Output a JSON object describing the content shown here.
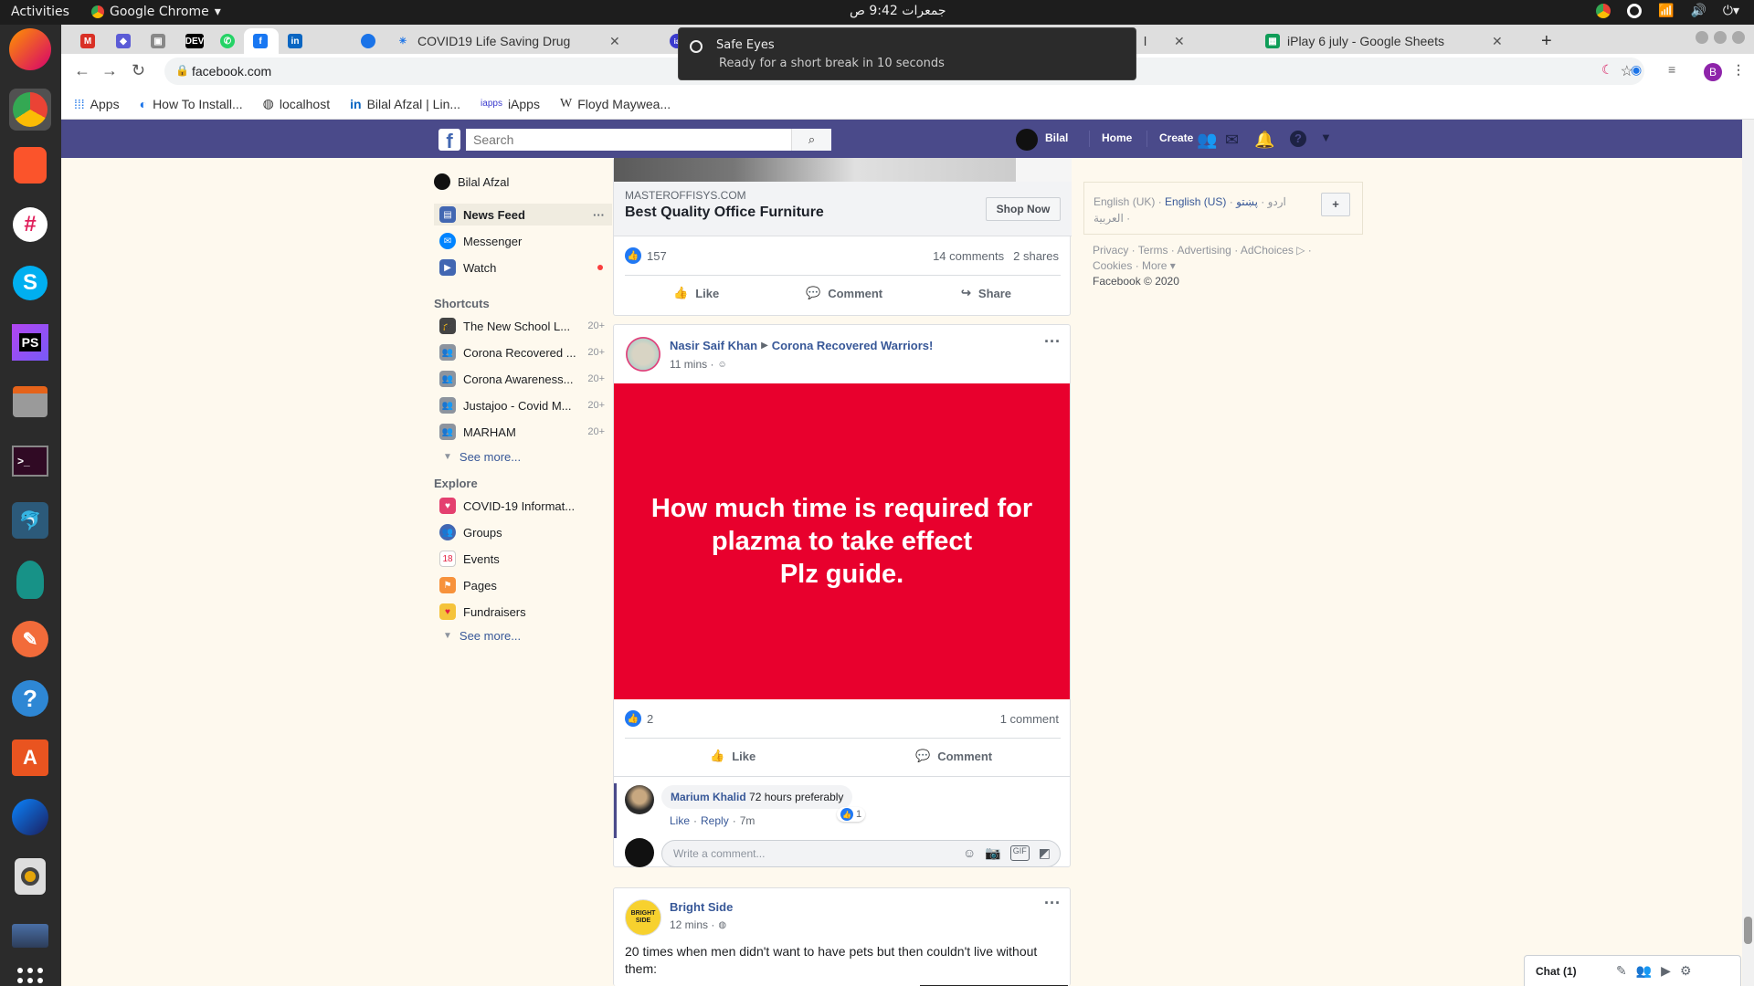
{
  "os": {
    "activities": "Activities",
    "app_name": "Google Chrome",
    "clock": "جمعرات 9:42 ص"
  },
  "notification": {
    "title": "Safe Eyes",
    "body": "Ready for a short break in 10 seconds"
  },
  "tabs": [
    {
      "label": "COVID19 Life Saving Drug"
    },
    {
      "label": "iApps"
    },
    {
      "label": "iPlay 6 july - Google Sheets"
    }
  ],
  "address_bar": {
    "url": "facebook.com"
  },
  "bookmarks": [
    {
      "label": "Apps"
    },
    {
      "label": "How To Install..."
    },
    {
      "label": "localhost"
    },
    {
      "label": "Bilal Afzal | Lin..."
    },
    {
      "label": "iApps"
    },
    {
      "label": "Floyd Maywea..."
    }
  ],
  "profile_initial": "B",
  "facebook": {
    "search_placeholder": "Search",
    "nav": {
      "user": "Bilal",
      "home": "Home",
      "create": "Create"
    },
    "left": {
      "profile_name": "Bilal Afzal",
      "main_items": [
        {
          "label": "News Feed"
        },
        {
          "label": "Messenger"
        },
        {
          "label": "Watch"
        }
      ],
      "shortcuts_heading": "Shortcuts",
      "shortcuts": [
        {
          "label": "The New School L...",
          "count": "20+"
        },
        {
          "label": "Corona Recovered ...",
          "count": "20+"
        },
        {
          "label": "Corona Awareness...",
          "count": "20+"
        },
        {
          "label": "Justajoo - Covid M...",
          "count": "20+"
        },
        {
          "label": "MARHAM",
          "count": "20+"
        }
      ],
      "see_more": "See more...",
      "explore_heading": "Explore",
      "explore": [
        {
          "label": "COVID-19 Informat..."
        },
        {
          "label": "Groups"
        },
        {
          "label": "Events"
        },
        {
          "label": "Pages"
        },
        {
          "label": "Fundraisers"
        }
      ]
    },
    "ad_post": {
      "domain": "MASTEROFFISYS.COM",
      "headline": "Best Quality Office Furniture",
      "cta": "Shop Now",
      "likes": "157",
      "comments": "14 comments",
      "shares": "2 shares",
      "like": "Like",
      "comment": "Comment",
      "share": "Share"
    },
    "post1": {
      "author": "Nasir Saif Khan",
      "group": "Corona Recovered Warriors!",
      "time": "11 mins ·",
      "text_lines": [
        "How much time is required for",
        "plazma to take effect",
        "Plz guide."
      ],
      "bg_color": "#e8002d",
      "likes": "2",
      "comments": "1 comment",
      "like": "Like",
      "comment": "Comment",
      "reply_author": "Marium Khalid",
      "reply_text": "72 hours preferably",
      "reply_like": "Like",
      "reply_reply": "Reply",
      "reply_time": "7m",
      "reply_reactions": "1",
      "write_placeholder": "Write a comment..."
    },
    "post2": {
      "author": "Bright Side",
      "avatar_text": "BRIGHT SIDE",
      "time": "12 mins ·",
      "text": "20 times when men didn't want to have pets but then couldn't live without them:"
    },
    "right": {
      "lang_uk": "English (UK)",
      "lang_us": "English (US)",
      "lang_urdu": "اردو",
      "lang_pashto": "پښتو",
      "lang_arabic": "العربية",
      "add": "+",
      "privacy": "Privacy",
      "terms": "Terms",
      "advertising": "Advertising",
      "adchoices": "AdChoices",
      "cookies": "Cookies",
      "more": "More",
      "copyright": "Facebook © 2020"
    },
    "chat_label": "Chat (1)"
  }
}
